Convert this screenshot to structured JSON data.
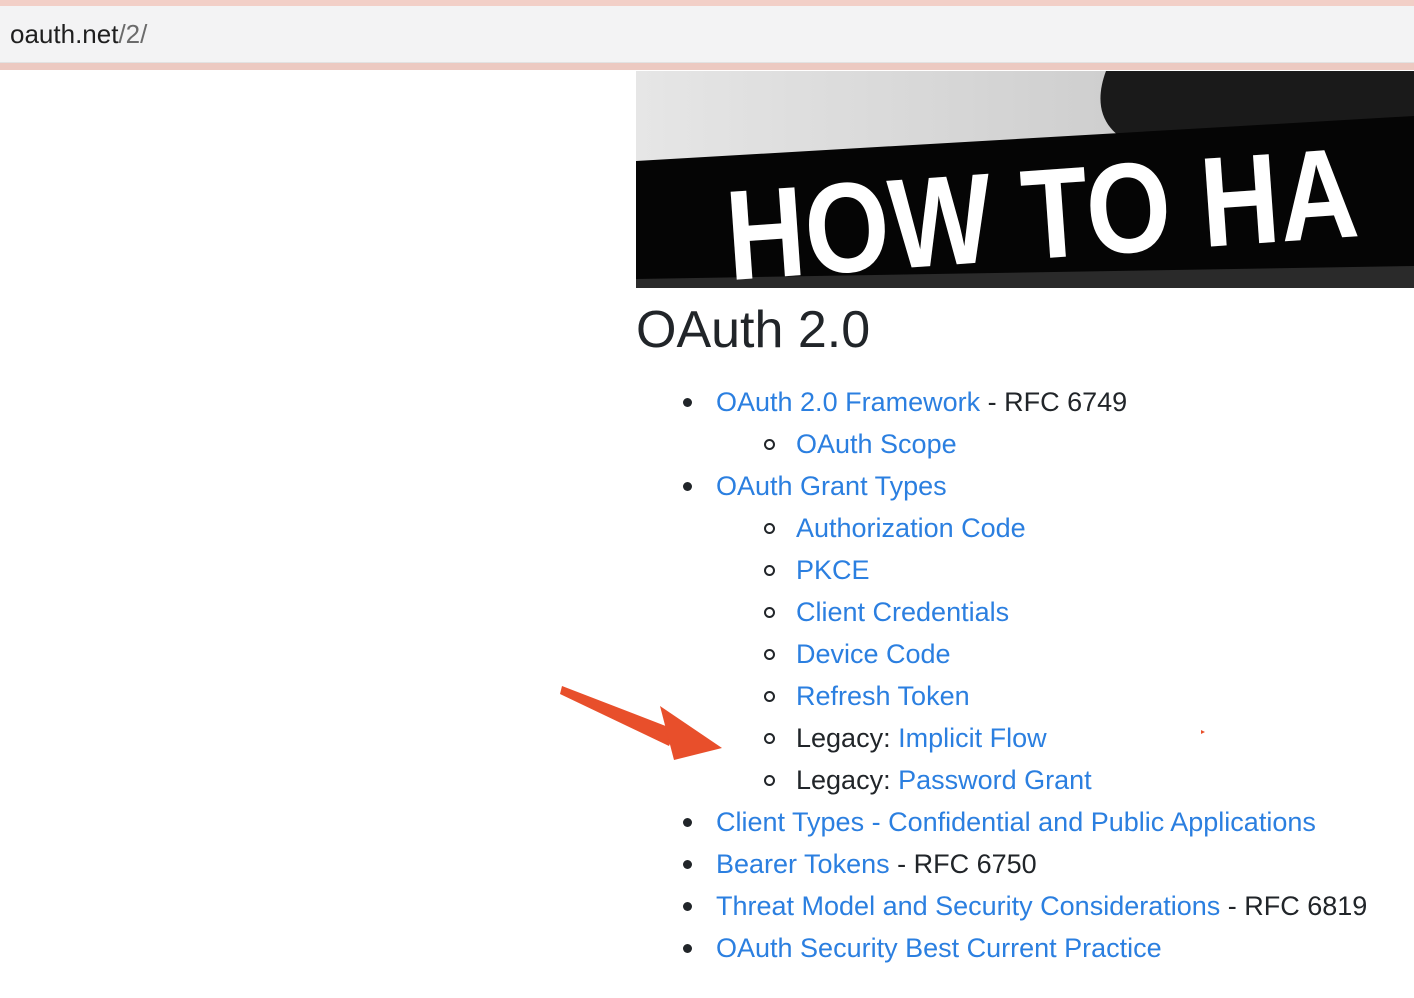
{
  "browser": {
    "url_domain": "oauth.net",
    "url_path": "/2/"
  },
  "hero": {
    "banner_text": "HOW TO HA"
  },
  "page": {
    "title": "OAuth 2.0"
  },
  "list": {
    "framework": {
      "link": "OAuth 2.0 Framework",
      "suffix": " - RFC 6749"
    },
    "scope": {
      "link": "OAuth Scope"
    },
    "grant_types": {
      "link": "OAuth Grant Types"
    },
    "authorization_code": {
      "link": "Authorization Code"
    },
    "pkce": {
      "link": "PKCE"
    },
    "client_credentials": {
      "link": "Client Credentials"
    },
    "device_code": {
      "link": "Device Code"
    },
    "refresh_token": {
      "link": "Refresh Token"
    },
    "implicit": {
      "prefix": "Legacy: ",
      "link": "Implicit Flow"
    },
    "password": {
      "prefix": "Legacy: ",
      "link": "Password Grant"
    },
    "client_types": {
      "link": "Client Types - Confidential and Public Applications"
    },
    "bearer": {
      "link": "Bearer Tokens",
      "suffix": " - RFC 6750"
    },
    "threat_model": {
      "link": "Threat Model and Security Considerations",
      "suffix": " - RFC 6819"
    },
    "best_practice": {
      "link": "OAuth Security Best Current Practice"
    }
  },
  "colors": {
    "link": "#2b7fe0",
    "arrow": "#e84f2b",
    "text": "#212529"
  },
  "icons": {
    "annotation_arrow": "arrow-annotation-icon"
  }
}
